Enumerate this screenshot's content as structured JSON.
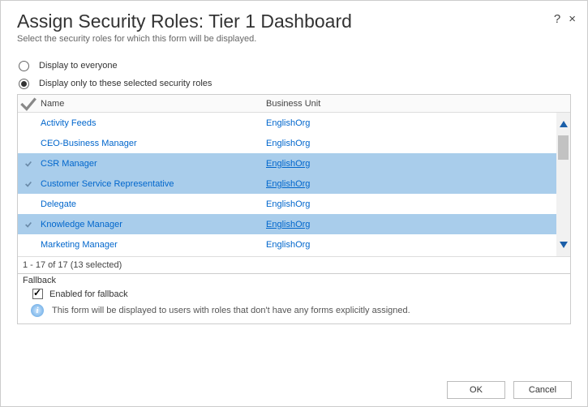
{
  "dialog": {
    "title": "Assign Security Roles: Tier 1 Dashboard",
    "subtitle": "Select the security roles for which this form will be displayed.",
    "help_icon": "?",
    "close_icon": "×"
  },
  "display_option": {
    "everyone": "Display to everyone",
    "selected_only": "Display only to these selected security roles",
    "chosen": "selected_only"
  },
  "grid": {
    "columns": {
      "name": "Name",
      "business_unit": "Business Unit"
    },
    "rows": [
      {
        "name": "Activity Feeds",
        "business_unit": "EnglishOrg",
        "selected": false
      },
      {
        "name": "CEO-Business Manager",
        "business_unit": "EnglishOrg",
        "selected": false
      },
      {
        "name": "CSR Manager",
        "business_unit": "EnglishOrg",
        "selected": true
      },
      {
        "name": "Customer Service Representative",
        "business_unit": "EnglishOrg",
        "selected": true
      },
      {
        "name": "Delegate",
        "business_unit": "EnglishOrg",
        "selected": false
      },
      {
        "name": "Knowledge Manager",
        "business_unit": "EnglishOrg",
        "selected": true
      },
      {
        "name": "Marketing Manager",
        "business_unit": "EnglishOrg",
        "selected": false
      }
    ],
    "pager": "1 - 17 of 17 (13 selected)"
  },
  "fallback": {
    "header": "Fallback",
    "enabled_label": "Enabled for fallback",
    "enabled": true,
    "info": "This form will be displayed to users with roles that don't have any forms explicitly assigned."
  },
  "buttons": {
    "ok": "OK",
    "cancel": "Cancel"
  }
}
